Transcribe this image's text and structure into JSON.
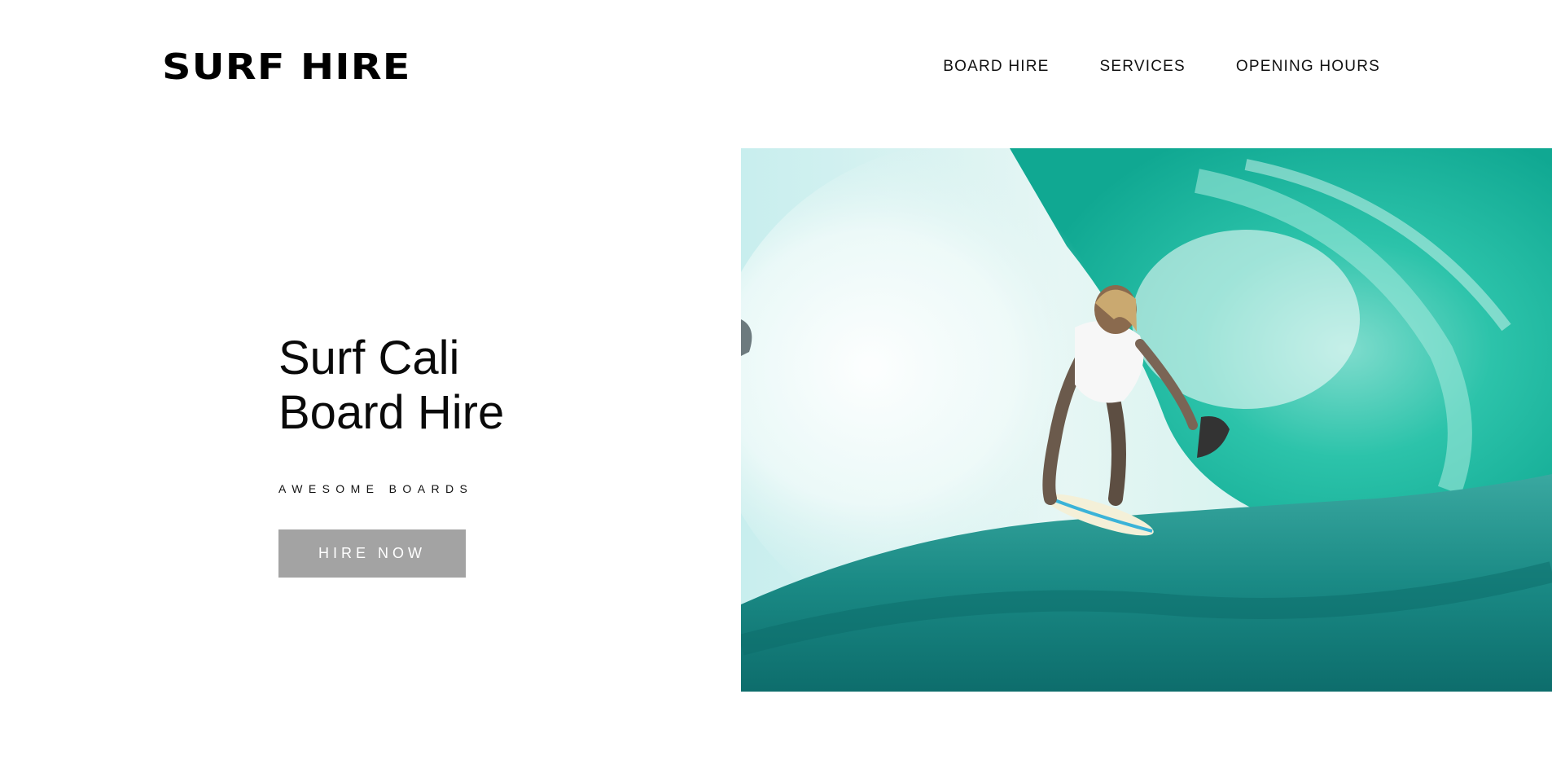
{
  "header": {
    "logo": "SURF HIRE",
    "nav": [
      {
        "label": "BOARD HIRE"
      },
      {
        "label": "SERVICES"
      },
      {
        "label": "OPENING HOURS"
      }
    ]
  },
  "hero": {
    "title_line1": "Surf Cali",
    "title_line2": "Board Hire",
    "subtitle": "AWESOME BOARDS",
    "button_label": "HIRE NOW",
    "image_subject": "surfer-in-wave-barrel-photo"
  },
  "colors": {
    "button_bg": "#a3a3a3",
    "wave_teal": "#1fb8a0",
    "deep_water": "#0f7e7a"
  }
}
